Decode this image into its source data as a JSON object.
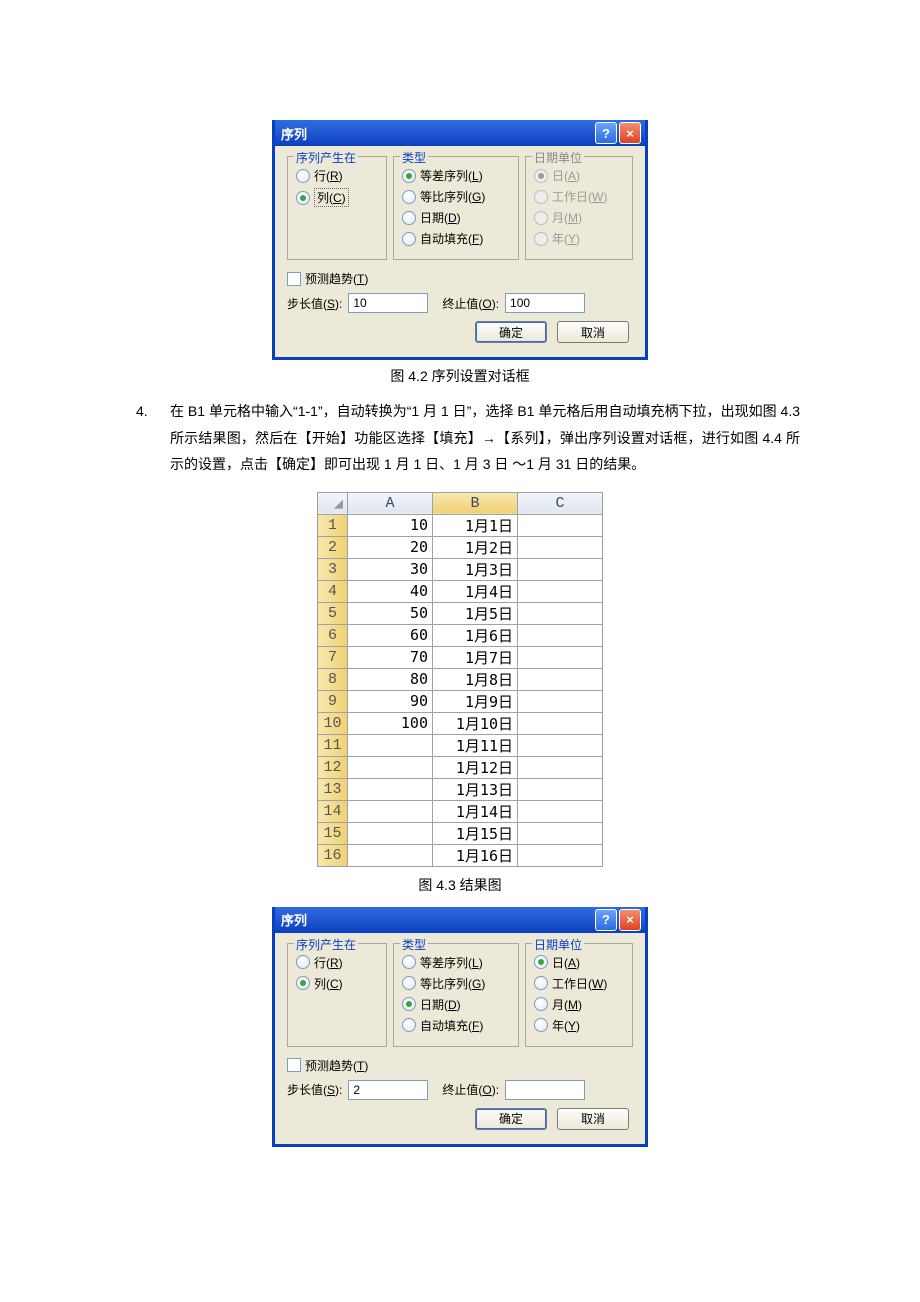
{
  "dialog1": {
    "title": "序列",
    "groups": {
      "produce_in": {
        "legend": "序列产生在",
        "row": "行(R)",
        "col": "列(C)"
      },
      "type": {
        "legend": "类型",
        "arith": "等差序列(L)",
        "geo": "等比序列(G)",
        "date": "日期(D)",
        "autofill": "自动填充(F)"
      },
      "date_unit": {
        "legend": "日期单位",
        "day": "日(A)",
        "workday": "工作日(W)",
        "month": "月(M)",
        "year": "年(Y)"
      }
    },
    "trend_label": "预测趋势(T)",
    "step_label": "步长值(S):",
    "step_value": "10",
    "stop_label": "终止值(O):",
    "stop_value": "100",
    "ok": "确定",
    "cancel": "取消"
  },
  "caption1": "图 4.2  序列设置对话框",
  "para4_marker": "4.",
  "para4_text": "在 B1 单元格中输入“1-1”，自动转换为“1 月 1 日”，选择 B1 单元格后用自动填充柄下拉，出现如图 4.3 所示结果图，然后在【开始】功能区选择【填充】→【系列】，弹出序列设置对话框，进行如图 4.4 所示的设置，点击【确定】即可出现 1 月 1 日、1 月 3 日 ～1 月 31 日的结果。",
  "sheet": {
    "cols": [
      "A",
      "B",
      "C"
    ],
    "rows": [
      {
        "n": "1",
        "A": "10",
        "B": "1月1日",
        "C": ""
      },
      {
        "n": "2",
        "A": "20",
        "B": "1月2日",
        "C": ""
      },
      {
        "n": "3",
        "A": "30",
        "B": "1月3日",
        "C": ""
      },
      {
        "n": "4",
        "A": "40",
        "B": "1月4日",
        "C": ""
      },
      {
        "n": "5",
        "A": "50",
        "B": "1月5日",
        "C": ""
      },
      {
        "n": "6",
        "A": "60",
        "B": "1月6日",
        "C": ""
      },
      {
        "n": "7",
        "A": "70",
        "B": "1月7日",
        "C": ""
      },
      {
        "n": "8",
        "A": "80",
        "B": "1月8日",
        "C": ""
      },
      {
        "n": "9",
        "A": "90",
        "B": "1月9日",
        "C": ""
      },
      {
        "n": "10",
        "A": "100",
        "B": "1月10日",
        "C": ""
      },
      {
        "n": "11",
        "A": "",
        "B": "1月11日",
        "C": ""
      },
      {
        "n": "12",
        "A": "",
        "B": "1月12日",
        "C": ""
      },
      {
        "n": "13",
        "A": "",
        "B": "1月13日",
        "C": ""
      },
      {
        "n": "14",
        "A": "",
        "B": "1月14日",
        "C": ""
      },
      {
        "n": "15",
        "A": "",
        "B": "1月15日",
        "C": ""
      },
      {
        "n": "16",
        "A": "",
        "B": "1月16日",
        "C": ""
      }
    ]
  },
  "caption2": "图 4.3 结果图",
  "dialog2": {
    "title": "序列",
    "groups": {
      "produce_in": {
        "legend": "序列产生在",
        "row": "行(R)",
        "col": "列(C)"
      },
      "type": {
        "legend": "类型",
        "arith": "等差序列(L)",
        "geo": "等比序列(G)",
        "date": "日期(D)",
        "autofill": "自动填充(F)"
      },
      "date_unit": {
        "legend": "日期单位",
        "day": "日(A)",
        "workday": "工作日(W)",
        "month": "月(M)",
        "year": "年(Y)"
      }
    },
    "trend_label": "预测趋势(T)",
    "step_label": "步长值(S):",
    "step_value": "2",
    "stop_label": "终止值(O):",
    "stop_value": "",
    "ok": "确定",
    "cancel": "取消"
  }
}
